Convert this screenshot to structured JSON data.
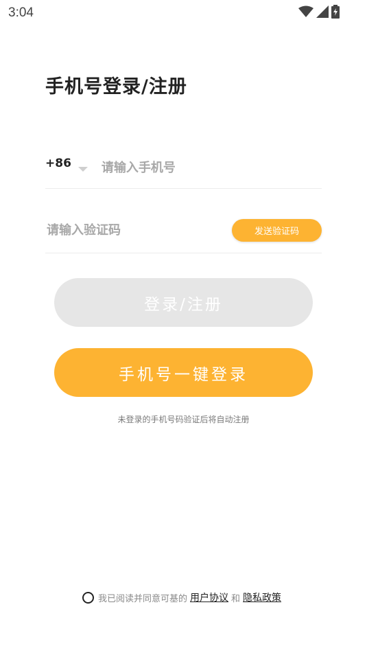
{
  "status_bar": {
    "time": "3:04",
    "icons": [
      "wifi-icon",
      "signal-icon",
      "battery-icon"
    ]
  },
  "title": "手机号登录/注册",
  "phone": {
    "country_code": "+86",
    "placeholder": "请输入手机号"
  },
  "code": {
    "placeholder": "请输入验证码",
    "send_label": "发送验证码"
  },
  "buttons": {
    "login_label": "登录/注册",
    "onekey_label": "手机号一键登录"
  },
  "hint": "未登录的手机号码验证后将自动注册",
  "agreement": {
    "prefix": "我已阅读并同意可基的",
    "user_agreement": "用户协议",
    "and": "和",
    "privacy_policy": "隐私政策"
  },
  "colors": {
    "accent": "#fdb332",
    "disabled_button": "#e6e6e6"
  }
}
